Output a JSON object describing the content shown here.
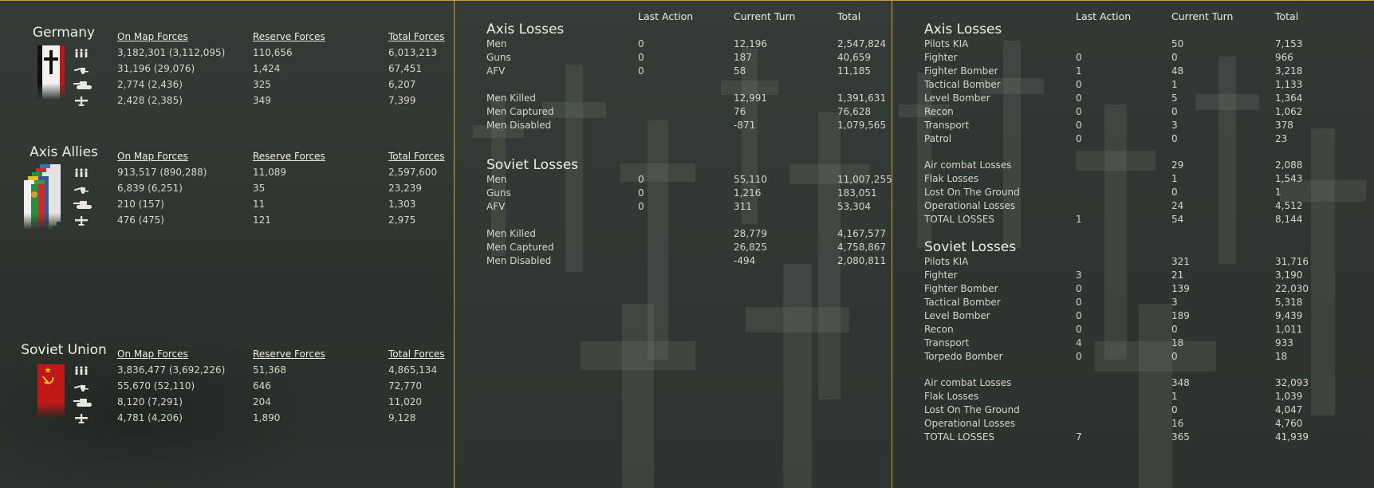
{
  "forces": {
    "headers": {
      "on_map": "On Map Forces",
      "reserve": "Reserve Forces",
      "total": "Total Forces"
    },
    "icons": [
      "infantry-icon",
      "gun-icon",
      "tank-icon",
      "aircraft-icon"
    ],
    "nations": [
      {
        "name": "Germany",
        "flag": "germany-flag",
        "rows": [
          {
            "on_map": "3,182,301 (3,112,095)",
            "reserve": "110,656",
            "total": "6,013,213"
          },
          {
            "on_map": "31,196 (29,076)",
            "reserve": "1,424",
            "total": "67,451"
          },
          {
            "on_map": "2,774 (2,436)",
            "reserve": "325",
            "total": "6,207"
          },
          {
            "on_map": "2,428 (2,385)",
            "reserve": "349",
            "total": "7,399"
          }
        ]
      },
      {
        "name": "Axis Allies",
        "flag": "axis-allies-flags",
        "rows": [
          {
            "on_map": "913,517 (890,288)",
            "reserve": "11,089",
            "total": "2,597,600"
          },
          {
            "on_map": "6,839 (6,251)",
            "reserve": "35",
            "total": "23,239"
          },
          {
            "on_map": "210 (157)",
            "reserve": "11",
            "total": "1,303"
          },
          {
            "on_map": "476 (475)",
            "reserve": "121",
            "total": "2,975"
          }
        ]
      },
      {
        "name": "Soviet Union",
        "flag": "soviet-flag",
        "rows": [
          {
            "on_map": "3,836,477 (3,692,226)",
            "reserve": "51,368",
            "total": "4,865,134"
          },
          {
            "on_map": "55,670 (52,110)",
            "reserve": "646",
            "total": "72,770"
          },
          {
            "on_map": "8,120 (7,291)",
            "reserve": "204",
            "total": "11,020"
          },
          {
            "on_map": "4,781 (4,206)",
            "reserve": "1,890",
            "total": "9,128"
          }
        ]
      }
    ]
  },
  "ground_losses": {
    "headers": {
      "last": "Last Action",
      "current": "Current Turn",
      "total": "Total"
    },
    "sections": [
      {
        "title": "Axis Losses",
        "rows": [
          {
            "label": "Men",
            "last": "0",
            "current": "12,196",
            "total": "2,547,824"
          },
          {
            "label": "Guns",
            "last": "0",
            "current": "187",
            "total": "40,659"
          },
          {
            "label": "AFV",
            "last": "0",
            "current": "58",
            "total": "11,185"
          }
        ],
        "rows2": [
          {
            "label": "Men Killed",
            "last": "",
            "current": "12,991",
            "total": "1,391,631"
          },
          {
            "label": "Men Captured",
            "last": "",
            "current": "76",
            "total": "76,628"
          },
          {
            "label": "Men Disabled",
            "last": "",
            "current": "-871",
            "total": "1,079,565"
          }
        ]
      },
      {
        "title": "Soviet Losses",
        "rows": [
          {
            "label": "Men",
            "last": "0",
            "current": "55,110",
            "total": "11,007,255"
          },
          {
            "label": "Guns",
            "last": "0",
            "current": "1,216",
            "total": "183,051"
          },
          {
            "label": "AFV",
            "last": "0",
            "current": "311",
            "total": "53,304"
          }
        ],
        "rows2": [
          {
            "label": "Men Killed",
            "last": "",
            "current": "28,779",
            "total": "4,167,577"
          },
          {
            "label": "Men Captured",
            "last": "",
            "current": "26,825",
            "total": "4,758,867"
          },
          {
            "label": "Men Disabled",
            "last": "",
            "current": "-494",
            "total": "2,080,811"
          }
        ]
      }
    ]
  },
  "air_losses": {
    "headers": {
      "last": "Last Action",
      "current": "Current Turn",
      "total": "Total"
    },
    "sections": [
      {
        "title": "Axis Losses",
        "rows": [
          {
            "label": "Pilots KIA",
            "last": "",
            "current": "50",
            "total": "7,153"
          },
          {
            "label": "Fighter",
            "last": "0",
            "current": "0",
            "total": "966"
          },
          {
            "label": "Fighter Bomber",
            "last": "1",
            "current": "48",
            "total": "3,218"
          },
          {
            "label": "Tactical Bomber",
            "last": "0",
            "current": "1",
            "total": "1,133"
          },
          {
            "label": "Level Bomber",
            "last": "0",
            "current": "5",
            "total": "1,364"
          },
          {
            "label": "Recon",
            "last": "0",
            "current": "0",
            "total": "1,062"
          },
          {
            "label": "Transport",
            "last": "0",
            "current": "3",
            "total": "378"
          },
          {
            "label": "Patrol",
            "last": "0",
            "current": "0",
            "total": "23"
          }
        ],
        "rows2": [
          {
            "label": "Air combat Losses",
            "last": "",
            "current": "29",
            "total": "2,088"
          },
          {
            "label": "Flak Losses",
            "last": "",
            "current": "1",
            "total": "1,543"
          },
          {
            "label": "Lost On The Ground",
            "last": "",
            "current": "0",
            "total": "1"
          },
          {
            "label": "Operational Losses",
            "last": "",
            "current": "24",
            "total": "4,512"
          },
          {
            "label": "TOTAL LOSSES",
            "last": "1",
            "current": "54",
            "total": "8,144"
          }
        ]
      },
      {
        "title": "Soviet Losses",
        "rows": [
          {
            "label": "Pilots KIA",
            "last": "",
            "current": "321",
            "total": "31,716"
          },
          {
            "label": "Fighter",
            "last": "3",
            "current": "21",
            "total": "3,190"
          },
          {
            "label": "Fighter Bomber",
            "last": "0",
            "current": "139",
            "total": "22,030"
          },
          {
            "label": "Tactical Bomber",
            "last": "0",
            "current": "3",
            "total": "5,318"
          },
          {
            "label": "Level Bomber",
            "last": "0",
            "current": "189",
            "total": "9,439"
          },
          {
            "label": "Recon",
            "last": "0",
            "current": "0",
            "total": "1,011"
          },
          {
            "label": "Transport",
            "last": "4",
            "current": "18",
            "total": "933"
          },
          {
            "label": "Torpedo Bomber",
            "last": "0",
            "current": "0",
            "total": "18"
          }
        ],
        "rows2": [
          {
            "label": "Air combat Losses",
            "last": "",
            "current": "348",
            "total": "32,093"
          },
          {
            "label": "Flak Losses",
            "last": "",
            "current": "1",
            "total": "1,039"
          },
          {
            "label": "Lost On The Ground",
            "last": "",
            "current": "0",
            "total": "4,047"
          },
          {
            "label": "Operational Losses",
            "last": "",
            "current": "16",
            "total": "4,760"
          },
          {
            "label": "TOTAL LOSSES",
            "last": "7",
            "current": "365",
            "total": "41,939"
          }
        ]
      }
    ]
  },
  "colors": {
    "border": "#c8a040",
    "text": "#d6d6cc",
    "heading": "#f0f0e6"
  }
}
